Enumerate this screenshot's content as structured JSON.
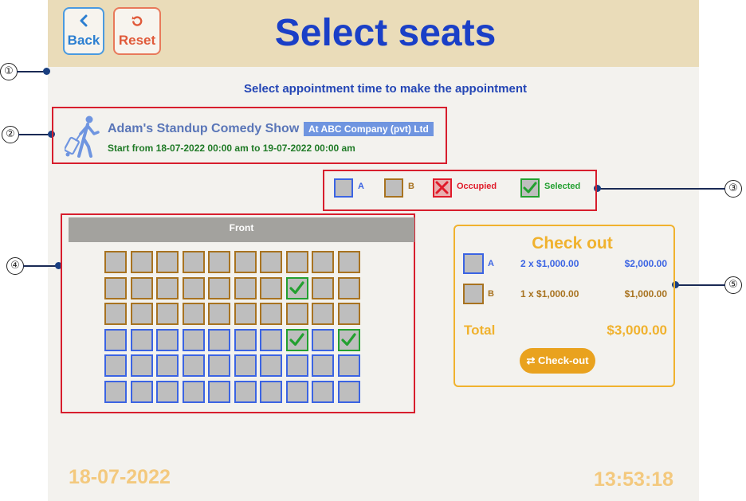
{
  "header": {
    "back_label": "Back",
    "reset_label": "Reset",
    "title": "Select seats",
    "back_icon": "chevron-left-icon",
    "reset_icon": "rotate-ccw-icon"
  },
  "subtitle": "Select appointment time to make the appointment",
  "callouts": [
    "①",
    "②",
    "③",
    "④",
    "⑤"
  ],
  "event": {
    "name": "Adam's Standup Comedy Show",
    "company": "At ABC Company (pvt) Ltd",
    "time": "Start from 18-07-2022 00:00 am to 19-07-2022 00:00 am",
    "icon": "walking-traveler-icon"
  },
  "legend": {
    "a": "A",
    "b": "B",
    "occupied": "Occupied",
    "selected": "Selected"
  },
  "seat_map": {
    "front_label": "Front",
    "rows": [
      [
        "B",
        "B",
        "B",
        "B",
        "B",
        "B",
        "B",
        "B",
        "B",
        "B"
      ],
      [
        "B",
        "B",
        "B",
        "B",
        "B",
        "B",
        "B",
        "S",
        "B",
        "B"
      ],
      [
        "B",
        "B",
        "B",
        "B",
        "B",
        "B",
        "B",
        "B",
        "B",
        "B"
      ],
      [
        "A",
        "A",
        "A",
        "A",
        "A",
        "A",
        "A",
        "S",
        "A",
        "S"
      ],
      [
        "A",
        "A",
        "A",
        "A",
        "A",
        "A",
        "A",
        "A",
        "A",
        "A"
      ],
      [
        "A",
        "A",
        "A",
        "A",
        "A",
        "A",
        "A",
        "A",
        "A",
        "A"
      ]
    ]
  },
  "checkout": {
    "title": "Check out",
    "lines": [
      {
        "type": "A",
        "qty": "2 x $1,000.00",
        "subtotal": "$2,000.00"
      },
      {
        "type": "B",
        "qty": "1 x $1,000.00",
        "subtotal": "$1,000.00"
      }
    ],
    "total_label": "Total",
    "total_value": "$3,000.00",
    "button_label": "⇄ Check-out"
  },
  "footer": {
    "date": "18-07-2022",
    "time": "13:53:18"
  },
  "colors": {
    "type_a": "#3b64e3",
    "type_b": "#a87320",
    "occupied": "#e01b2a",
    "selected": "#23a030",
    "accent": "#f0b22e"
  }
}
